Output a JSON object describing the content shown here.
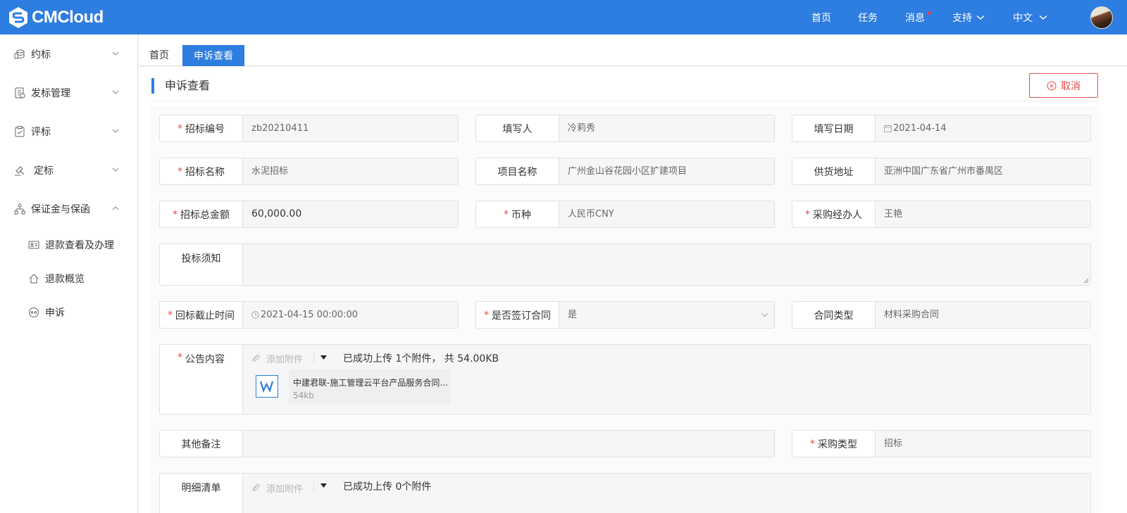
{
  "brand": {
    "name": "CMCloud"
  },
  "topnav": {
    "home": "首页",
    "tasks": "任务",
    "messages": "消息",
    "support": "支持",
    "language": "中文"
  },
  "colors": {
    "primary": "#2e7de0",
    "required": "#e34b4b",
    "notify_dot": "#ff3b3b"
  },
  "sidebar": {
    "items": [
      {
        "label": "约标",
        "icon": "coins-icon",
        "expanded": false
      },
      {
        "label": "发标管理",
        "icon": "document-list-icon",
        "expanded": false
      },
      {
        "label": "评标",
        "icon": "clipboard-check-icon",
        "expanded": false
      },
      {
        "label": "定标",
        "icon": "gavel-icon",
        "expanded": false
      },
      {
        "label": "保证金与保函",
        "icon": "org-chart-icon",
        "expanded": true,
        "children": [
          {
            "label": "退款查看及办理",
            "icon": "id-card-icon"
          },
          {
            "label": "退款概览",
            "icon": "home-icon"
          },
          {
            "label": "申诉",
            "icon": "appeal-icon"
          }
        ]
      }
    ]
  },
  "tabs": [
    {
      "label": "首页",
      "active": false
    },
    {
      "label": "申诉查看",
      "active": true
    }
  ],
  "page": {
    "title": "申诉查看",
    "cancel_label": "取消"
  },
  "form": {
    "bid_no": {
      "label": "招标编号",
      "required": true,
      "value": "zb20210411"
    },
    "filler": {
      "label": "填写人",
      "required": false,
      "value": "冷莉秀"
    },
    "fill_date": {
      "label": "填写日期",
      "required": false,
      "value": "2021-04-14"
    },
    "bid_name": {
      "label": "招标名称",
      "required": true,
      "value": "水泥招标"
    },
    "project_name": {
      "label": "项目名称",
      "required": false,
      "value": "广州金山谷花园小区扩建项目"
    },
    "supply_address": {
      "label": "供货地址",
      "required": false,
      "value": "亚洲中国广东省广州市番禺区"
    },
    "total_amount": {
      "label": "招标总金额",
      "required": true,
      "value": "60,000.00"
    },
    "currency": {
      "label": "币种",
      "required": true,
      "value": "人民币CNY"
    },
    "purchaser": {
      "label": "采购经办人",
      "required": true,
      "value": "王艳"
    },
    "notice": {
      "label": "投标须知",
      "required": false,
      "value": ""
    },
    "deadline": {
      "label": "回标截止时间",
      "required": true,
      "value": "2021-04-15 00:00:00"
    },
    "sign_contract": {
      "label": "是否签订合同",
      "required": true,
      "value": "是"
    },
    "contract_type": {
      "label": "合同类型",
      "required": false,
      "value": "材料采购合同"
    },
    "announcement": {
      "label": "公告内容",
      "required": true,
      "add_label": "添加附件",
      "status": "已成功上传 1个附件， 共 54.00KB",
      "file": {
        "name": "中建君联-施工管理云平台产品服务合同...",
        "size": "54kb"
      }
    },
    "other_notes": {
      "label": "其他备注",
      "required": false,
      "value": ""
    },
    "purchase_type": {
      "label": "采购类型",
      "required": true,
      "value": "招标"
    },
    "detail_list": {
      "label": "明细清单",
      "required": false,
      "add_label": "添加附件",
      "status": "已成功上传 0个附件"
    }
  }
}
